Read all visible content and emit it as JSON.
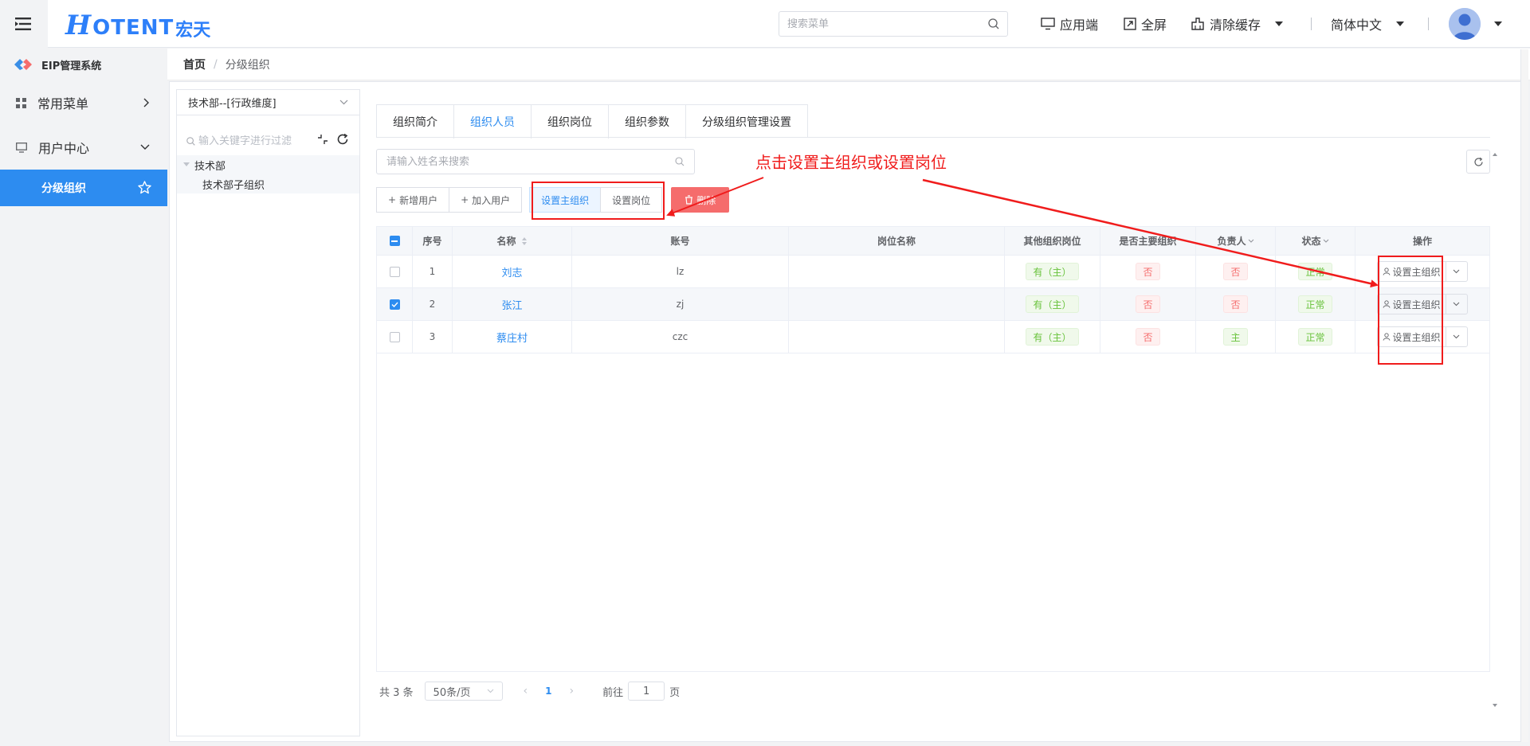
{
  "header": {
    "brand_mark": "H",
    "brand_text": "OTENT",
    "brand_cn": "宏天",
    "search_placeholder": "搜索菜单",
    "actions": {
      "app": "应用端",
      "fullscreen": "全屏",
      "clear_cache": "清除缓存",
      "language": "简体中文"
    }
  },
  "sidebar": {
    "system_title": "EIP管理系统",
    "items": [
      {
        "label": "常用菜单"
      },
      {
        "label": "用户中心"
      },
      {
        "label": "分级组织"
      }
    ]
  },
  "breadcrumb": {
    "home": "首页",
    "separator": "/",
    "current": "分级组织"
  },
  "tree": {
    "dimension": "技术部--[行政维度]",
    "search_placeholder": "输入关键字进行过滤",
    "nodes": [
      {
        "label": "技术部"
      },
      {
        "label": "技术部子组织"
      }
    ]
  },
  "tabs": [
    {
      "label": "组织简介"
    },
    {
      "label": "组织人员"
    },
    {
      "label": "组织岗位"
    },
    {
      "label": "组织参数"
    },
    {
      "label": "分级组织管理设置"
    }
  ],
  "toolbar": {
    "search_placeholder": "请输入姓名来搜索",
    "add_user": "新增用户",
    "join_user": "加入用户",
    "set_main_org": "设置主组织",
    "set_post": "设置岗位",
    "delete": "删除"
  },
  "table": {
    "columns": [
      "序号",
      "名称",
      "账号",
      "岗位名称",
      "其他组织岗位",
      "是否主要组织",
      "负责人",
      "状态",
      "操作"
    ],
    "rows": [
      {
        "idx": "1",
        "name": "刘志",
        "account": "lz",
        "post": "",
        "other": "有（主）",
        "is_main": "否",
        "leader": "否",
        "status": "正常",
        "op": "设置主组织",
        "checked": false
      },
      {
        "idx": "2",
        "name": "张江",
        "account": "zj",
        "post": "",
        "other": "有（主）",
        "is_main": "否",
        "leader": "否",
        "status": "正常",
        "op": "设置主组织",
        "checked": true
      },
      {
        "idx": "3",
        "name": "蔡庄村",
        "account": "czc",
        "post": "",
        "other": "有（主）",
        "is_main": "否",
        "leader": "主",
        "status": "正常",
        "op": "设置主组织",
        "checked": false
      }
    ]
  },
  "pager": {
    "total": "共 3 条",
    "page_size": "50条/页",
    "current_page": "1",
    "goto_prefix": "前往",
    "goto_value": "1",
    "goto_suffix": "页"
  },
  "annotation": {
    "text": "点击设置主组织或设置岗位",
    "color": "#f01c1c"
  },
  "colors": {
    "primary": "#2d8cf0",
    "danger": "#f56c6c",
    "success": "#67c23a"
  }
}
